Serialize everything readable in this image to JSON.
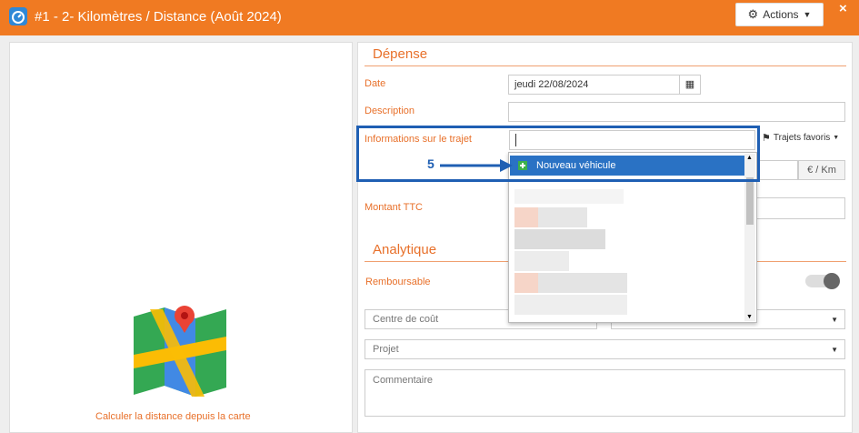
{
  "window": {
    "title": "#1 -  2- Kilomètres / Distance (Août 2024)",
    "actions_label": "Actions",
    "close_symbol": "×"
  },
  "left_panel": {
    "map_icon": "map-pin-icon",
    "calculate_link": "Calculer la distance depuis la carte"
  },
  "depense": {
    "section_title": "Dépense",
    "date_label": "Date",
    "date_value": "jeudi 22/08/2024",
    "description_label": "Description",
    "trajet_label": "Informations sur le trajet",
    "trajets_favoris_label": "Trajets favoris",
    "unit_label": "€ / Km",
    "montant_label": "Montant TTC"
  },
  "dropdown": {
    "items": [
      "Nouveau véhicule"
    ]
  },
  "analytique": {
    "section_title": "Analytique",
    "remboursable_label": "Remboursable",
    "centre_cout_placeholder": "Centre de coût",
    "projet_placeholder": "Projet",
    "commentaire_placeholder": "Commentaire"
  },
  "annotation": {
    "step_number": "5"
  },
  "colors": {
    "accent": "#f07a22",
    "highlight": "#1f5fb3",
    "selection": "#2a72c4"
  }
}
